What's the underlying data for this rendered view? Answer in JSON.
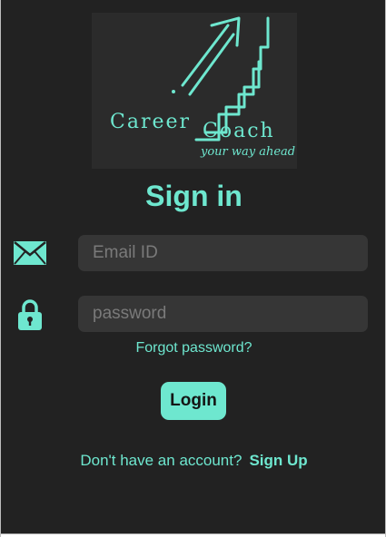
{
  "logo": {
    "word1": "Career",
    "word2": "Coach",
    "tagline": "your way ahead",
    "icon": "stairs-arrow-icon"
  },
  "title": "Sign in",
  "email": {
    "placeholder": "Email ID",
    "value": "",
    "icon": "mail-icon"
  },
  "password": {
    "placeholder": "password",
    "value": "",
    "icon": "lock-icon"
  },
  "forgot_label": "Forgot password?",
  "login_label": "Login",
  "signup": {
    "prompt": "Don't have an account?",
    "link": "Sign Up"
  },
  "colors": {
    "accent": "#6ee7cf",
    "background": "#222222",
    "field": "#363636"
  }
}
